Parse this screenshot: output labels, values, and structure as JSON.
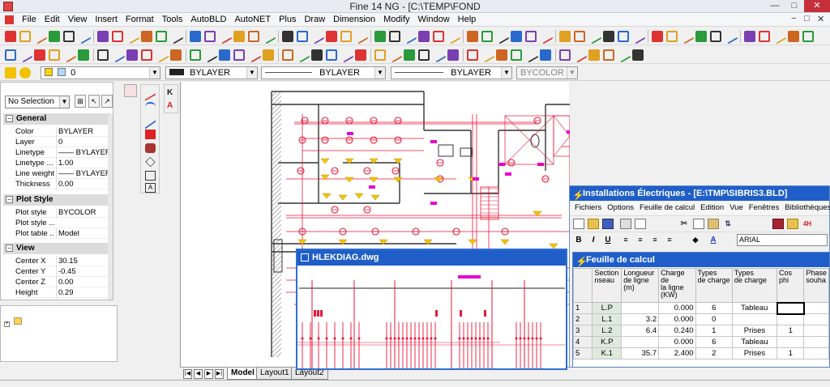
{
  "app": {
    "title": "Fine 14 NG  - [C:\\TEMP\\FOND",
    "min_label": "—",
    "max_label": "□",
    "close_label": "✕"
  },
  "menu": {
    "items": [
      "File",
      "Edit",
      "View",
      "Insert",
      "Format",
      "Tools",
      "AutoBLD",
      "AutoNET",
      "Plus",
      "Draw",
      "Dimension",
      "Modify",
      "Window",
      "Help"
    ],
    "mdi_controls": [
      "−",
      "□",
      "✕"
    ]
  },
  "propbar": {
    "layer": "0",
    "color": "BYLAYER",
    "linetype": "BYLAYER",
    "lineweight": "BYLAYER",
    "plotstyle": "BYCOLOR"
  },
  "properties": {
    "selection": "No Selection",
    "general_title": "General",
    "general": [
      {
        "k": "Color",
        "v": "BYLAYER"
      },
      {
        "k": "Layer",
        "v": "0"
      },
      {
        "k": "Linetype",
        "v": "—— BYLAYER"
      },
      {
        "k": "Linetype ...",
        "v": "1.00"
      },
      {
        "k": "Line weight",
        "v": "—— BYLAYER"
      },
      {
        "k": "Thickness",
        "v": "0.00"
      }
    ],
    "plot_title": "Plot Style",
    "plot": [
      {
        "k": "Plot style",
        "v": "BYCOLOR"
      },
      {
        "k": "Plot style ...",
        "v": ""
      },
      {
        "k": "Plot table ...",
        "v": "Model"
      }
    ],
    "view_title": "View",
    "view": [
      {
        "k": "Center X",
        "v": "30.15"
      },
      {
        "k": "Center Y",
        "v": "-0.45"
      },
      {
        "k": "Center Z",
        "v": "0.00"
      },
      {
        "k": "Height",
        "v": "0.29"
      }
    ]
  },
  "layout_tabs": [
    "Model",
    "Layout1",
    "Layout2"
  ],
  "hlek_window": {
    "title": "HLEKDIAG.dwg"
  },
  "install_window": {
    "title": "Installations Électriques - [E:\\TMP\\SIBRIS3.BLD]",
    "menu": [
      "Fichiers",
      "Options",
      "Feuille de calcul",
      "Edition",
      "Vue",
      "Fenêtres",
      "Bibliothèques",
      "Aide"
    ],
    "font": "ARIAL",
    "bold": "B",
    "italic": "I",
    "underline": "U"
  },
  "sheet_window": {
    "title": "Feuille de calcul",
    "headers": [
      "Section\nnseau",
      "Longueur\nde ligne (m)",
      "Charge de\nla ligne\n(KW)",
      "Types\nde charge",
      "Types\nde charge",
      "Cos phi",
      "Phase\nsouha"
    ],
    "rows": [
      {
        "n": "1",
        "section": "L.P",
        "longueur": "",
        "charge": "0.000",
        "types": "6",
        "type_label": "Tableau",
        "cos": "",
        "phase": ""
      },
      {
        "n": "2",
        "section": "L.1",
        "longueur": "3.2",
        "charge": "0.000",
        "types": "0",
        "type_label": "",
        "cos": "",
        "phase": ""
      },
      {
        "n": "3",
        "section": "L.2",
        "longueur": "6.4",
        "charge": "0.240",
        "types": "1",
        "type_label": "Prises",
        "cos": "1",
        "phase": ""
      },
      {
        "n": "4",
        "section": "K.P",
        "longueur": "",
        "charge": "0.000",
        "types": "6",
        "type_label": "Tableau",
        "cos": "",
        "phase": ""
      },
      {
        "n": "5",
        "section": "K.1",
        "longueur": "35.7",
        "charge": "2.400",
        "types": "2",
        "type_label": "Prises",
        "cos": "1",
        "phase": ""
      }
    ]
  },
  "colors": {
    "accent": "#1f5ec9",
    "drawing_red": "#e8163a",
    "lamp_yellow": "#f5c400",
    "highlight_magenta": "#e800d0"
  }
}
